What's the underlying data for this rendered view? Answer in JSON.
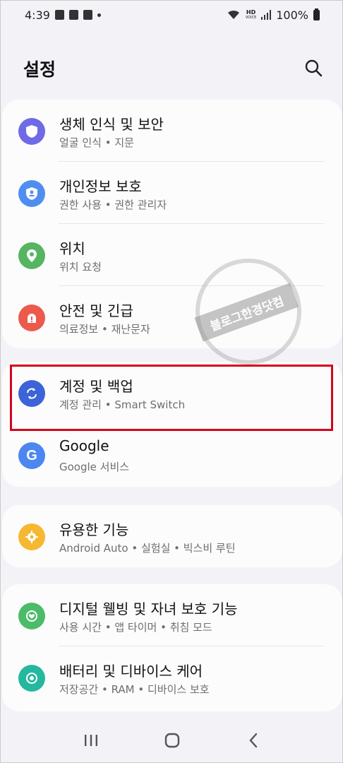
{
  "status_bar": {
    "time": "4:39",
    "network_label": "HD",
    "network_sub": "VOICE",
    "battery": "100%"
  },
  "header": {
    "title": "설정"
  },
  "groups": [
    {
      "items": [
        {
          "title": "생체 인식 및 보안",
          "subtitle": "얼굴 인식 • 지문",
          "icon": "shield-icon",
          "color": "#6e6be5"
        },
        {
          "title": "개인정보 보호",
          "subtitle": "권한 사용 • 권한 관리자",
          "icon": "privacy-icon",
          "color": "#4f8ef0"
        },
        {
          "title": "위치",
          "subtitle": "위치 요청",
          "icon": "location-pin-icon",
          "color": "#56b561"
        },
        {
          "title": "안전 및 긴급",
          "subtitle": "의료정보 • 재난문자",
          "icon": "emergency-icon",
          "color": "#ec5a4c"
        }
      ]
    },
    {
      "items": [
        {
          "title": "계정 및 백업",
          "subtitle": "계정 관리 • Smart Switch",
          "icon": "sync-icon",
          "color": "#3c64d8"
        },
        {
          "title": "Google",
          "subtitle": "Google 서비스",
          "icon": "google-icon",
          "color": "#4c86f0"
        }
      ]
    },
    {
      "items": [
        {
          "title": "유용한 기능",
          "subtitle": "Android Auto • 실험실 • 빅스비 루틴",
          "icon": "puzzle-gear-icon",
          "color": "#f6b731"
        }
      ]
    },
    {
      "items": [
        {
          "title": "디지털 웰빙 및 자녀 보호 기능",
          "subtitle": "사용 시간 • 앱 타이머 • 취침 모드",
          "icon": "wellbeing-icon",
          "color": "#4cbb6a"
        },
        {
          "title": "배터리 및 디바이스 케어",
          "subtitle": "저장공간 • RAM • 디바이스 보호",
          "icon": "device-care-icon",
          "color": "#25b89e"
        }
      ]
    }
  ],
  "watermark": {
    "text": "블로그한경닷컴"
  }
}
